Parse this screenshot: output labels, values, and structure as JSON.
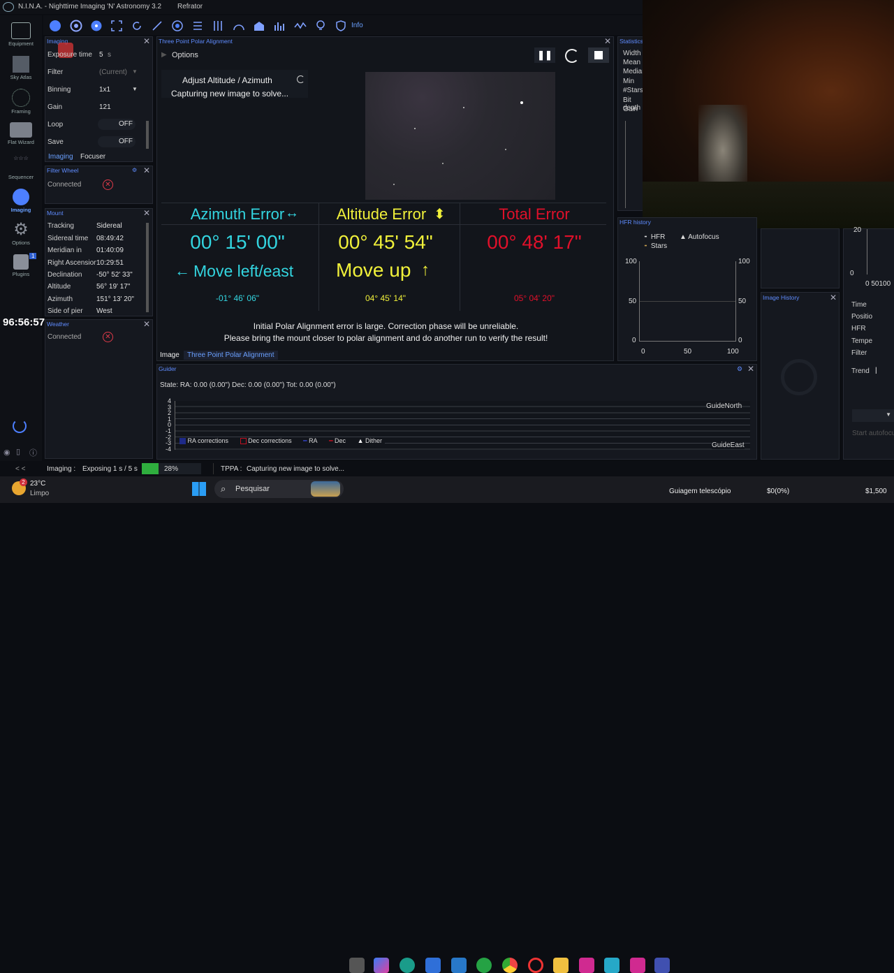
{
  "window": {
    "title": "N.I.N.A. - Nighttime Imaging 'N' Astronomy 3.2",
    "profile": "Refrator"
  },
  "toolbar": {
    "info_label": "Info"
  },
  "nav": [
    {
      "label": "Equipment"
    },
    {
      "label": "Sky Atlas"
    },
    {
      "label": "Framing"
    },
    {
      "label": "Flat Wizard"
    },
    {
      "label": "Sequencer"
    },
    {
      "label": "Imaging"
    },
    {
      "label": "Options"
    },
    {
      "label": "Plugins"
    }
  ],
  "plugins_badge": "1",
  "timer": "96:56:57",
  "imaging_panel": {
    "title": "Imaging",
    "rows": [
      {
        "label": "Exposure time",
        "value": "5",
        "unit": "s"
      },
      {
        "label": "Filter",
        "value": "(Current)"
      },
      {
        "label": "Binning",
        "value": "1x1"
      },
      {
        "label": "Gain",
        "value": "121"
      },
      {
        "label": "Loop",
        "value": "OFF"
      },
      {
        "label": "Save",
        "value": "OFF"
      }
    ],
    "tabs": [
      "Imaging",
      "Focuser"
    ]
  },
  "filter_wheel": {
    "title": "Filter Wheel",
    "status": "Connected"
  },
  "mount": {
    "title": "Mount",
    "rows": [
      {
        "label": "Tracking",
        "value": "Sidereal"
      },
      {
        "label": "Sidereal time",
        "value": "08:49:42"
      },
      {
        "label": "Meridian in",
        "value": "01:40:09"
      },
      {
        "label": "Right Ascension",
        "value": "10:29:51"
      },
      {
        "label": "Declination",
        "value": "-50° 52' 33\""
      },
      {
        "label": "Altitude",
        "value": "56° 19' 17\""
      },
      {
        "label": "Azimuth",
        "value": "151° 13' 20\""
      },
      {
        "label": "Side of pier",
        "value": "West"
      }
    ]
  },
  "weather": {
    "title": "Weather",
    "status": "Connected"
  },
  "tppa": {
    "title": "Three Point Polar Alignment",
    "options_label": "Options",
    "step_title": "Adjust Altitude / Azimuth",
    "step_status": "Capturing new image to solve...",
    "azimuth": {
      "title": "Azimuth Error",
      "value": "00° 15' 00\"",
      "move": "Move left/east",
      "small": "-01° 46' 06\""
    },
    "altitude": {
      "title": "Altitude Error",
      "value": "00° 45' 54\"",
      "move": "Move up",
      "small": "04° 45' 14\""
    },
    "total": {
      "title": "Total Error",
      "value": "00° 48' 17\"",
      "small": "05° 04' 20\""
    },
    "warning_line1": "Initial Polar Alignment error is large. Correction phase will be unreliable.",
    "warning_line2": "Please bring the mount closer to polar alignment and do another run to verify the result!",
    "tabs": [
      "Image",
      "Three Point Polar Alignment"
    ]
  },
  "statistics": {
    "title": "Statistics",
    "labels": [
      "Width",
      "Mean",
      "Median",
      "Min",
      "#Stars",
      "Bit depth",
      "Gain"
    ]
  },
  "hfr_history": {
    "title": "HFR history",
    "legend": [
      "HFR",
      "Autofocus",
      "Stars"
    ],
    "y_ticks": [
      "100",
      "50",
      "0"
    ],
    "x_ticks": [
      "0",
      "50",
      "100"
    ]
  },
  "image_history": {
    "title": "Image History"
  },
  "focuser_side": {
    "labels": [
      "Time",
      "Position",
      "HFR",
      "Temperature",
      "Filter",
      "Trend"
    ],
    "y_ticks": [
      "20",
      "0"
    ],
    "x_ticks": "0 50100",
    "start_label": "Start autofocus"
  },
  "guider": {
    "title": "Guider",
    "state": "State:  RA: 0.00 (0.00\")  Dec: 0.00 (0.00\")  Tot: 0.00 (0.00\")",
    "y_ticks": [
      "4",
      "3",
      "2",
      "1",
      "0",
      "-1",
      "-2",
      "-3",
      "-4"
    ],
    "north_label": "GuideNorth",
    "east_label": "GuideEast",
    "legend": [
      "RA corrections",
      "Dec corrections",
      "RA",
      "Dec",
      "Dither"
    ],
    "colors": {
      "ra": "#2430a8",
      "dec": "#c01020"
    }
  },
  "statusbar": {
    "collapse": "< <",
    "imaging_label": "Imaging :",
    "imaging_status": "Exposing 1 s / 5 s",
    "progress_text": "28%",
    "progress": 0.28,
    "tppa_label": "TPPA :",
    "tppa_status": "Capturing new image to solve..."
  },
  "taskbar": {
    "weather_badge": "2",
    "temperature": "23°C",
    "condition": "Limpo",
    "search_placeholder": "Pesquisar",
    "active_app": "Guiagem telescópio",
    "balance": "$0(0%)",
    "amount": "$1,500"
  }
}
